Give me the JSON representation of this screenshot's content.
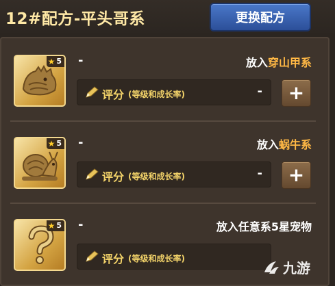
{
  "header": {
    "title": "12#配方-平头哥系",
    "change_button": "更换配方"
  },
  "rows": [
    {
      "star_count": "5",
      "name": "-",
      "put_prefix": "放入",
      "put_type": "穿山甲系",
      "score_label": "评分",
      "score_sub": "(等级和成长率)",
      "score_value": "-",
      "plus_label": "+",
      "icon": "pangolin-icon"
    },
    {
      "star_count": "5",
      "name": "-",
      "put_prefix": "放入",
      "put_type": "蜗牛系",
      "score_label": "评分",
      "score_sub": "(等级和成长率)",
      "score_value": "-",
      "plus_label": "+",
      "icon": "snail-icon"
    },
    {
      "star_count": "5",
      "name": "-",
      "put_prefix": "放入任意系5星宠物",
      "put_type": "",
      "score_label": "评分",
      "score_sub": "(等级和成长率)",
      "score_value": "",
      "plus_label": "",
      "icon": "question-mark-icon"
    }
  ],
  "watermark": {
    "text": "九游",
    "icon": "jiuyou-logo-icon"
  },
  "colors": {
    "background": "#2b2520",
    "title": "#ffe9a6",
    "highlight": "#ffb845",
    "score": "#f4d46a",
    "button_blue": "#2c4f99",
    "plus_brown": "#7a5a3b"
  }
}
